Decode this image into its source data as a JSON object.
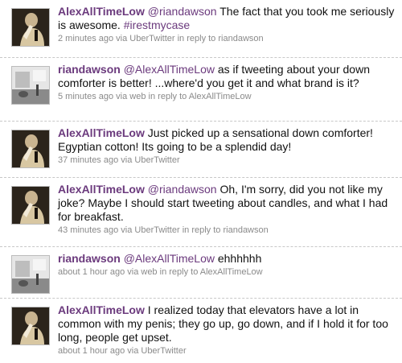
{
  "tweets": [
    {
      "author": "AlexAllTimeLow",
      "mention": "@riandawson",
      "text_before": "",
      "text_after": " The fact that you took me seriously is awesome. ",
      "hashtag": "#irestmycase",
      "time": "2 minutes ago",
      "via_prefix": "via",
      "source": "UberTwitter",
      "reply_prefix": "in reply to",
      "reply_to": "riandawson",
      "avatar": "alex-avatar"
    },
    {
      "author": "riandawson",
      "mention": "@AlexAllTimeLow",
      "text_after": " as if tweeting about your down comforter is better! ...where'd you get it and what brand is it?",
      "time": "5 minutes ago",
      "via_prefix": "via",
      "source": "web",
      "reply_prefix": "in reply to",
      "reply_to": "AlexAllTimeLow",
      "avatar": "rian-avatar"
    },
    {
      "author": "AlexAllTimeLow",
      "text_after": " Just picked up a sensational down comforter! Egyptian cotton! Its going to be a splendid day!",
      "time": "37 minutes ago",
      "via_prefix": "via",
      "source": "UberTwitter",
      "avatar": "alex-avatar"
    },
    {
      "author": "AlexAllTimeLow",
      "mention": "@riandawson",
      "text_after": " Oh, I'm sorry, did you not like my joke? Maybe I should start tweeting about candles, and what I had for breakfast.",
      "time": "43 minutes ago",
      "via_prefix": "via",
      "source": "UberTwitter",
      "reply_prefix": "in reply to",
      "reply_to": "riandawson",
      "avatar": "alex-avatar"
    },
    {
      "author": "riandawson",
      "mention": "@AlexAllTimeLow",
      "text_after": " ehhhhhh",
      "time": "about 1 hour ago",
      "via_prefix": "via",
      "source": "web",
      "reply_prefix": "in reply to",
      "reply_to": "AlexAllTimeLow",
      "avatar": "rian-avatar"
    },
    {
      "author": "AlexAllTimeLow",
      "text_after": " I realized today that elevators have a lot in common with my penis; they go up, go down, and if I hold it for too long, people get upset.",
      "time": "about 1 hour ago",
      "via_prefix": "via",
      "source": "UberTwitter",
      "avatar": "alex-avatar"
    }
  ],
  "colors": {
    "username": "#6b3a7d",
    "meta": "#8a8a8a",
    "divider": "#c8c8c8"
  }
}
